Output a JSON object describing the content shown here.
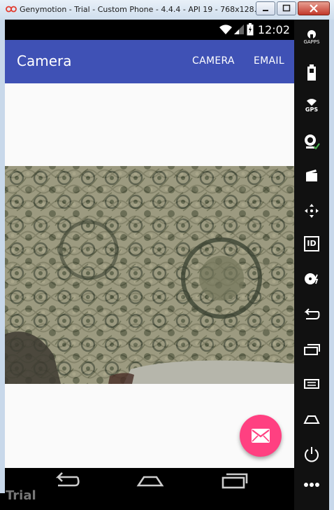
{
  "window": {
    "title": "Genymotion - Trial - Custom Phone - 4.4.4 - API 19 - 768x128..."
  },
  "status_bar": {
    "time": "12:02"
  },
  "app_bar": {
    "title": "Camera",
    "actions": [
      {
        "label": "CAMERA"
      },
      {
        "label": "EMAIL"
      }
    ]
  },
  "side_panel": {
    "gapps_label": "GAPPS",
    "gps_label": "GPS",
    "id_label": "ID"
  },
  "watermark": "Trial",
  "colors": {
    "primary": "#3f51b5",
    "accent": "#ff4081",
    "background": "#fafafa"
  }
}
